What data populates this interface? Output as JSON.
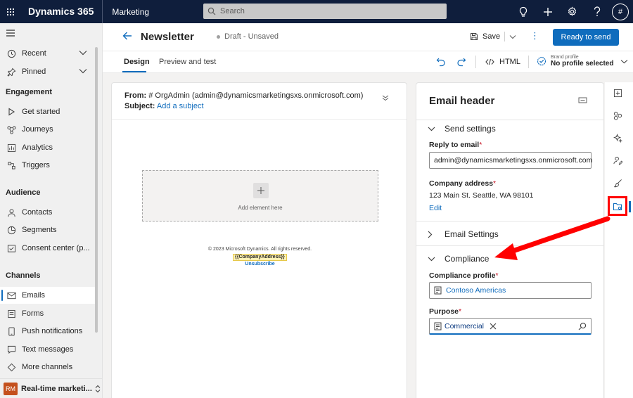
{
  "topbar": {
    "brand": "Dynamics 365",
    "app": "Marketing",
    "search_placeholder": "Search",
    "avatar": "#"
  },
  "sidebar": {
    "recent": "Recent",
    "pinned": "Pinned",
    "sections": [
      {
        "heading": "Engagement",
        "items": [
          "Get started",
          "Journeys",
          "Analytics",
          "Triggers"
        ]
      },
      {
        "heading": "Audience",
        "items": [
          "Contacts",
          "Segments",
          "Consent center (p..."
        ]
      },
      {
        "heading": "Channels",
        "items": [
          "Emails",
          "Forms",
          "Push notifications",
          "Text messages",
          "More channels"
        ]
      }
    ],
    "area_badge": "RM",
    "area_name": "Real-time marketi..."
  },
  "header": {
    "title": "Newsletter",
    "status": "Draft - Unsaved",
    "save": "Save",
    "ready": "Ready to send"
  },
  "tabs": {
    "design": "Design",
    "preview": "Preview and test",
    "html": "HTML",
    "brand_label": "Brand profile",
    "brand_value": "No profile selected"
  },
  "canvas": {
    "from_label": "From:",
    "from_value": "# OrgAdmin (admin@dynamicsmarketingsxs.onmicrosoft.com)",
    "subject_label": "Subject:",
    "subject_link": "Add a subject",
    "add_element": "Add element here",
    "copyright": "© 2023 Microsoft Dynamics. All rights reserved.",
    "company_token": "{{CompanyAddress}}",
    "unsubscribe": "Unsubscribe"
  },
  "panel": {
    "title": "Email header",
    "send_settings": "Send settings",
    "reply_label": "Reply to email",
    "reply_value": "admin@dynamicsmarketingsxs.onmicrosoft.com",
    "address_label": "Company address",
    "address_value": "123 Main St. Seattle, WA 98101",
    "edit": "Edit",
    "email_settings": "Email Settings",
    "compliance": "Compliance",
    "profile_label": "Compliance profile",
    "profile_value": "Contoso Americas",
    "purpose_label": "Purpose",
    "purpose_value": "Commercial",
    "required_mark": "*"
  },
  "colors": {
    "accent": "#0f6cbd",
    "topbar": "#0f1e3c",
    "annotation": "#ff0000"
  }
}
